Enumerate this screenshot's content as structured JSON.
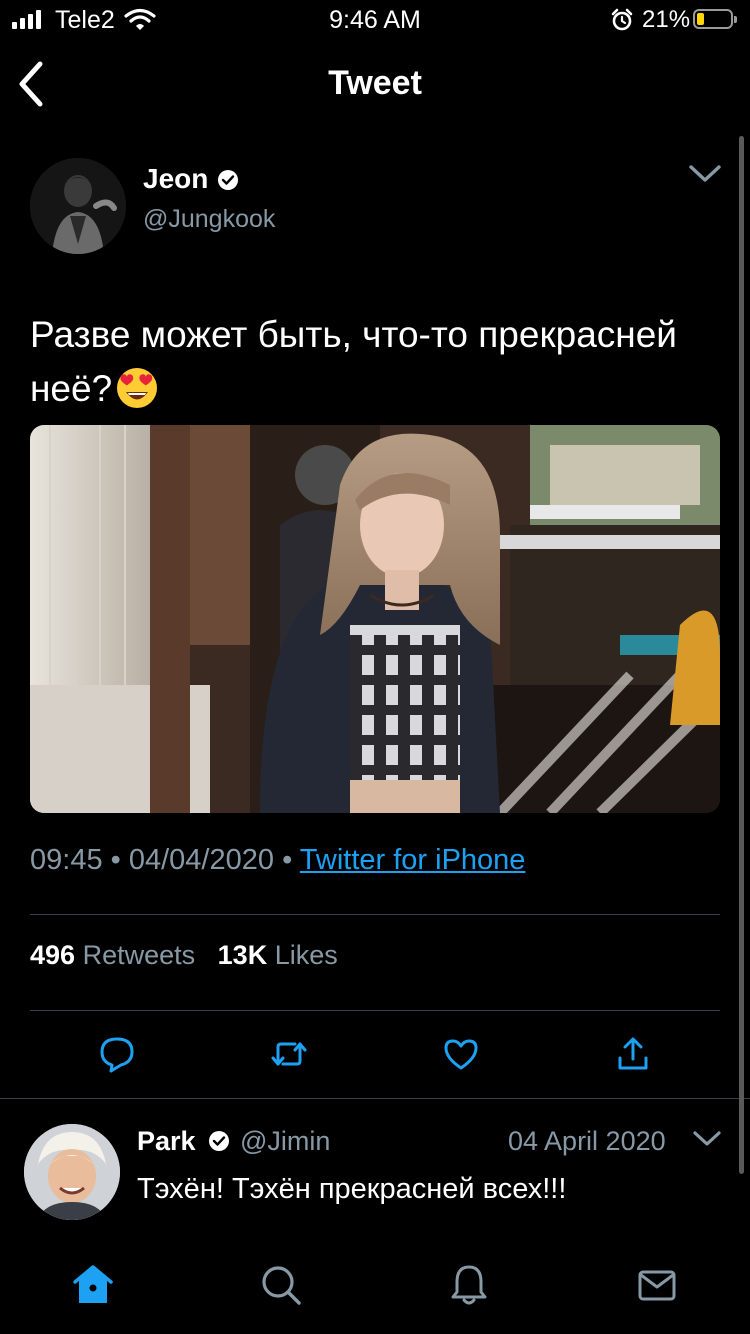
{
  "status_bar": {
    "carrier": "Tele2",
    "time": "9:46 AM",
    "battery_pct": "21%"
  },
  "header": {
    "title": "Tweet"
  },
  "tweet": {
    "author_name": "Jeon",
    "author_handle": "@Jungkook",
    "text": "Разве может быть, что-то прекрасней неё?",
    "time": "09:45",
    "date": "04/04/2020",
    "source": "Twitter for iPhone",
    "retweets_count": "496",
    "retweets_label": "Retweets",
    "likes_count": "13K",
    "likes_label": "Likes"
  },
  "reply": {
    "author_name": "Park",
    "author_handle": "@Jimin",
    "date": "04 April 2020",
    "text": "Тэхён! Тэхён прекрасней всех!!!"
  },
  "icons": {
    "back": "chevron-left-icon",
    "actions": [
      "reply-icon",
      "retweet-icon",
      "like-icon",
      "share-icon"
    ],
    "tabs": [
      "home-icon",
      "search-icon",
      "notifications-icon",
      "messages-icon"
    ]
  },
  "colors": {
    "accent": "#1da1f2",
    "muted": "#8899a6",
    "divider": "#38444d",
    "background": "#000000"
  }
}
